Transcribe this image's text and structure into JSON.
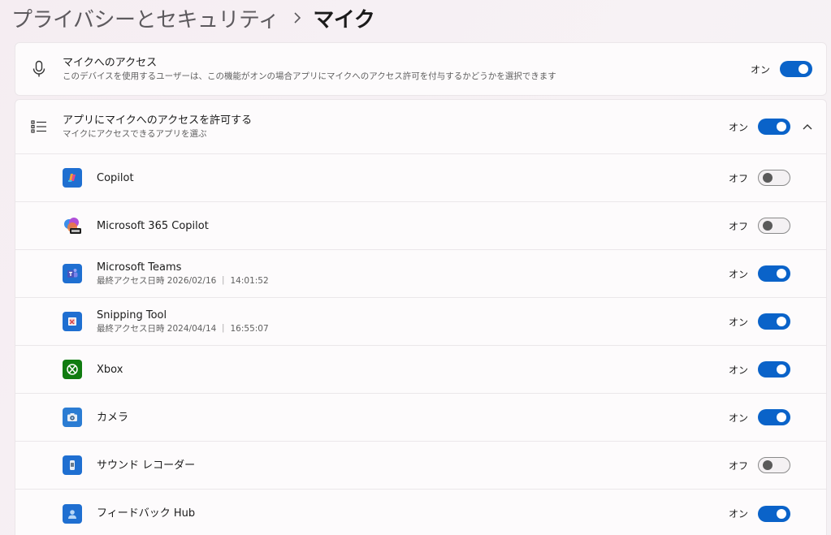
{
  "breadcrumb": {
    "parent": "プライバシーとセキュリティ",
    "current": "マイク"
  },
  "mic_access": {
    "title": "マイクへのアクセス",
    "description": "このデバイスを使用するユーザーは、この機能がオンの場合アプリにマイクへのアクセス許可を付与するかどうかを選択できます",
    "state_label": "オン",
    "on": true,
    "icon": "microphone-icon"
  },
  "app_access": {
    "title": "アプリにマイクへのアクセスを許可する",
    "description": "マイクにアクセスできるアプリを選ぶ",
    "state_label": "オン",
    "on": true,
    "icon": "list-icon",
    "expanded": true
  },
  "apps": [
    {
      "name": "Copilot",
      "sub": "",
      "state_label": "オフ",
      "on": false,
      "icon": "copilot-icon"
    },
    {
      "name": "Microsoft 365 Copilot",
      "sub": "",
      "state_label": "オフ",
      "on": false,
      "icon": "m365-copilot-icon"
    },
    {
      "name": "Microsoft Teams",
      "sub": "最終アクセス日時 2026/02/16 ｜ 14:01:52",
      "state_label": "オン",
      "on": true,
      "icon": "teams-icon"
    },
    {
      "name": "Snipping Tool",
      "sub": "最終アクセス日時 2024/04/14 ｜ 16:55:07",
      "state_label": "オン",
      "on": true,
      "icon": "snipping-tool-icon"
    },
    {
      "name": "Xbox",
      "sub": "",
      "state_label": "オン",
      "on": true,
      "icon": "xbox-icon"
    },
    {
      "name": "カメラ",
      "sub": "",
      "state_label": "オン",
      "on": true,
      "icon": "camera-icon"
    },
    {
      "name": "サウンド レコーダー",
      "sub": "",
      "state_label": "オフ",
      "on": false,
      "icon": "sound-recorder-icon"
    },
    {
      "name": "フィードバック Hub",
      "sub": "",
      "state_label": "オン",
      "on": true,
      "icon": "feedback-hub-icon"
    }
  ],
  "colors": {
    "accent": "#0a63c9",
    "toggle_off_knob": "#5a5a5a",
    "xbox_green": "#107c10"
  }
}
